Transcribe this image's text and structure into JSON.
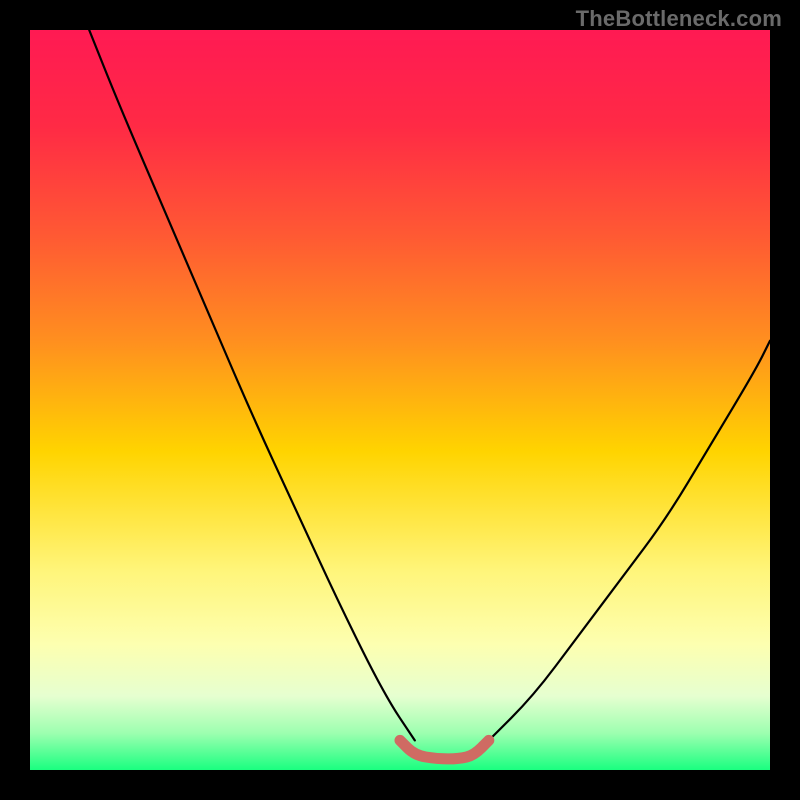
{
  "watermark": "TheBottleneck.com",
  "colors": {
    "background": "#000000",
    "curve": "#000000",
    "smile": "#cf6b63",
    "gradient_stops": [
      {
        "offset": 0.0,
        "color": "#ff1a53"
      },
      {
        "offset": 0.13,
        "color": "#ff2a45"
      },
      {
        "offset": 0.28,
        "color": "#ff5a33"
      },
      {
        "offset": 0.42,
        "color": "#ff8f1f"
      },
      {
        "offset": 0.57,
        "color": "#ffd400"
      },
      {
        "offset": 0.73,
        "color": "#fff57a"
      },
      {
        "offset": 0.83,
        "color": "#fdffb0"
      },
      {
        "offset": 0.9,
        "color": "#e6ffd0"
      },
      {
        "offset": 0.95,
        "color": "#9dffb0"
      },
      {
        "offset": 1.0,
        "color": "#1aff80"
      }
    ]
  },
  "chart_data": {
    "type": "line",
    "title": "",
    "xlabel": "",
    "ylabel": "",
    "xlim": [
      0,
      100
    ],
    "ylim": [
      0,
      100
    ],
    "series": [
      {
        "name": "left-curve",
        "x": [
          8,
          12,
          18,
          24,
          30,
          36,
          42,
          48,
          52
        ],
        "y": [
          100,
          90,
          76,
          62,
          48,
          35,
          22,
          10,
          4
        ]
      },
      {
        "name": "right-curve",
        "x": [
          62,
          68,
          74,
          80,
          86,
          92,
          98,
          100
        ],
        "y": [
          4,
          10,
          18,
          26,
          34,
          44,
          54,
          58
        ]
      },
      {
        "name": "bottom-smile",
        "x": [
          50,
          52,
          55,
          58,
          60,
          62
        ],
        "y": [
          4,
          2,
          1.5,
          1.5,
          2,
          4
        ]
      }
    ],
    "annotations": [
      {
        "text": "TheBottleneck.com",
        "position": "top-right"
      }
    ]
  }
}
